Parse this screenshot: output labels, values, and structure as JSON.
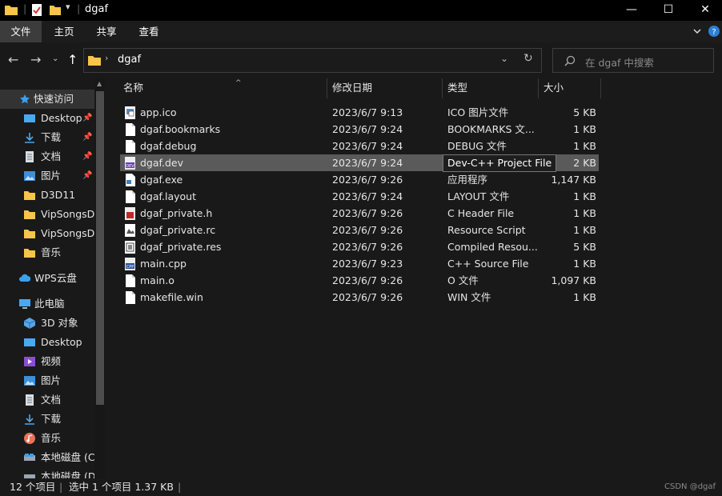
{
  "window": {
    "title": "dgaf",
    "minimize": "—",
    "maximize": "☐",
    "close": "✕"
  },
  "ribbon": {
    "tabs": [
      {
        "label": "文件"
      },
      {
        "label": "主页"
      },
      {
        "label": "共享"
      },
      {
        "label": "查看"
      }
    ]
  },
  "address": {
    "path": "dgaf",
    "search_placeholder": "在 dgaf 中搜索"
  },
  "sidebar": {
    "items": [
      {
        "label": "快速访问",
        "icon": "star-icon",
        "pinned": false
      },
      {
        "label": "Desktop",
        "icon": "desktop-icon",
        "pinned": true
      },
      {
        "label": "下载",
        "icon": "download-icon",
        "pinned": true
      },
      {
        "label": "文档",
        "icon": "document-icon",
        "pinned": true
      },
      {
        "label": "图片",
        "icon": "picture-icon",
        "pinned": true
      },
      {
        "label": "D3D11",
        "icon": "folder-icon",
        "pinned": false
      },
      {
        "label": "VipSongsDo",
        "icon": "folder-icon",
        "pinned": false
      },
      {
        "label": "VipSongsDo",
        "icon": "folder-icon",
        "pinned": false
      },
      {
        "label": "音乐",
        "icon": "folder-icon",
        "pinned": false
      },
      {
        "label": "WPS云盘",
        "icon": "cloud-icon",
        "pinned": false
      },
      {
        "label": "此电脑",
        "icon": "computer-icon",
        "pinned": false
      },
      {
        "label": "3D 对象",
        "icon": "3d-objects-icon",
        "pinned": false
      },
      {
        "label": "Desktop",
        "icon": "desktop-icon",
        "pinned": false
      },
      {
        "label": "视频",
        "icon": "video-icon",
        "pinned": false
      },
      {
        "label": "图片",
        "icon": "picture-icon",
        "pinned": false
      },
      {
        "label": "文档",
        "icon": "document-icon",
        "pinned": false
      },
      {
        "label": "下载",
        "icon": "download-icon",
        "pinned": false
      },
      {
        "label": "音乐",
        "icon": "music-icon",
        "pinned": false
      },
      {
        "label": "本地磁盘 (C",
        "icon": "drive-icon",
        "pinned": false
      },
      {
        "label": "本地磁盘 (D",
        "icon": "drive-icon",
        "pinned": false
      }
    ]
  },
  "columns": {
    "name": "名称",
    "date": "修改日期",
    "type": "类型",
    "size": "大小"
  },
  "files": [
    {
      "name": "app.ico",
      "date": "2023/6/7 9:13",
      "type": "ICO 图片文件",
      "size": "5 KB",
      "icon": "image-file-icon"
    },
    {
      "name": "dgaf.bookmarks",
      "date": "2023/6/7 9:24",
      "type": "BOOKMARKS 文...",
      "size": "1 KB",
      "icon": "file-icon"
    },
    {
      "name": "dgaf.debug",
      "date": "2023/6/7 9:24",
      "type": "DEBUG 文件",
      "size": "1 KB",
      "icon": "file-icon"
    },
    {
      "name": "dgaf.dev",
      "date": "2023/6/7 9:24",
      "type": "",
      "size": "2 KB",
      "icon": "dev-project-icon",
      "selected": true
    },
    {
      "name": "dgaf.exe",
      "date": "2023/6/7 9:26",
      "type": "应用程序",
      "size": "1,147 KB",
      "icon": "exe-icon"
    },
    {
      "name": "dgaf.layout",
      "date": "2023/6/7 9:24",
      "type": "LAYOUT 文件",
      "size": "1 KB",
      "icon": "file-icon"
    },
    {
      "name": "dgaf_private.h",
      "date": "2023/6/7 9:26",
      "type": "C Header File",
      "size": "1 KB",
      "icon": "header-file-icon"
    },
    {
      "name": "dgaf_private.rc",
      "date": "2023/6/7 9:26",
      "type": "Resource Script",
      "size": "1 KB",
      "icon": "resource-script-icon"
    },
    {
      "name": "dgaf_private.res",
      "date": "2023/6/7 9:26",
      "type": "Compiled Resou...",
      "size": "5 KB",
      "icon": "compiled-resource-icon"
    },
    {
      "name": "main.cpp",
      "date": "2023/6/7 9:23",
      "type": "C++ Source File",
      "size": "1 KB",
      "icon": "cpp-file-icon"
    },
    {
      "name": "main.o",
      "date": "2023/6/7 9:26",
      "type": "O 文件",
      "size": "1,097 KB",
      "icon": "file-icon"
    },
    {
      "name": "makefile.win",
      "date": "2023/6/7 9:26",
      "type": "WIN 文件",
      "size": "1 KB",
      "icon": "file-icon"
    }
  ],
  "tooltip": {
    "text": "Dev-C++ Project File"
  },
  "status": {
    "count": "12 个项目",
    "selection": "选中 1 个项目  1.37 KB",
    "watermark": "CSDN @dgaf"
  },
  "colors": {
    "background": "#191919",
    "folder": "#f8c44a",
    "selected_row": "#5a5a5a"
  }
}
